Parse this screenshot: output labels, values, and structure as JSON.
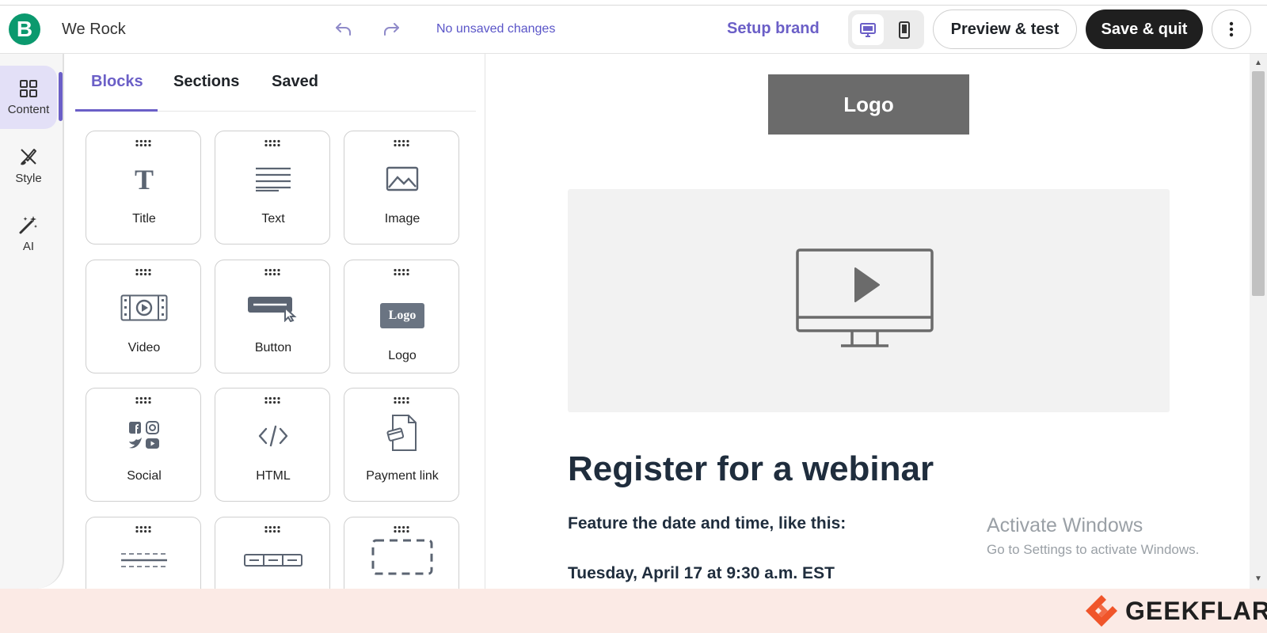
{
  "app": {
    "title": "We Rock",
    "logo_letter": "B",
    "brand_color": "#0b996e"
  },
  "toolbar": {
    "status": "No unsaved changes",
    "setup_brand": "Setup brand",
    "preview_label": "Preview & test",
    "save_label": "Save & quit",
    "accent": "#6b5fc7"
  },
  "rail": {
    "items": [
      {
        "label": "Content",
        "icon": "grid-icon",
        "active": true
      },
      {
        "label": "Style",
        "icon": "brush-icon",
        "active": false
      },
      {
        "label": "AI",
        "icon": "magic-wand-icon",
        "active": false
      }
    ]
  },
  "panel": {
    "tabs": [
      {
        "label": "Blocks",
        "active": true
      },
      {
        "label": "Sections",
        "active": false
      },
      {
        "label": "Saved",
        "active": false
      }
    ],
    "blocks": [
      {
        "label": "Title",
        "icon": "title-icon"
      },
      {
        "label": "Text",
        "icon": "text-icon"
      },
      {
        "label": "Image",
        "icon": "image-icon"
      },
      {
        "label": "Video",
        "icon": "video-icon"
      },
      {
        "label": "Button",
        "icon": "button-icon"
      },
      {
        "label": "Logo",
        "icon": "logo-icon"
      },
      {
        "label": "Social",
        "icon": "social-icon"
      },
      {
        "label": "HTML",
        "icon": "html-icon"
      },
      {
        "label": "Payment link",
        "icon": "payment-link-icon"
      },
      {
        "label": "",
        "icon": "divider-icon"
      },
      {
        "label": "",
        "icon": "navigation-icon"
      },
      {
        "label": "",
        "icon": "spacer-icon"
      }
    ],
    "logo_glyph_text": "Logo"
  },
  "canvas": {
    "logo_text": "Logo",
    "heading": "Register for a webinar",
    "line1": "Feature the date and time, like this:",
    "line2": "Tuesday, April 17 at 9:30 a.m. EST"
  },
  "watermark": {
    "line1": "Activate Windows",
    "line2": "Go to Settings to activate Windows."
  },
  "footer": {
    "brand": "GEEKFLARE"
  }
}
